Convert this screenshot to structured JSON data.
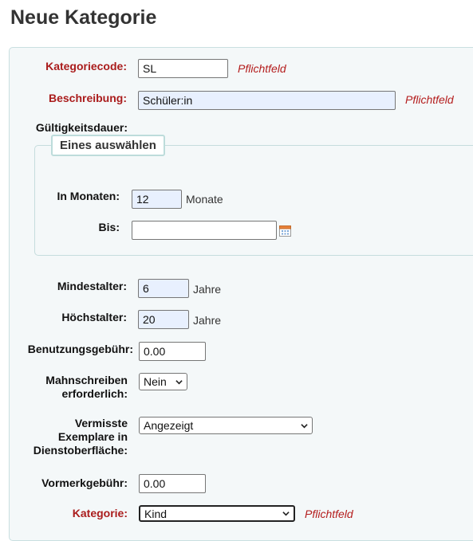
{
  "page": {
    "title": "Neue Kategorie"
  },
  "form": {
    "category_code": {
      "label": "Kategoriecode:",
      "value": "SL",
      "required": "Pflichtfeld"
    },
    "description": {
      "label": "Beschreibung:",
      "value": "Schüler:in",
      "required": "Pflichtfeld"
    },
    "validity": {
      "label": "Gültigkeitsdauer:",
      "legend": "Eines auswählen",
      "months": {
        "label": "In Monaten:",
        "value": "12",
        "unit": "Monate"
      },
      "until": {
        "label": "Bis:",
        "value": "",
        "icon": "calendar-icon"
      }
    },
    "min_age": {
      "label": "Mindestalter:",
      "value": "6",
      "unit": "Jahre"
    },
    "max_age": {
      "label": "Höchstalter:",
      "value": "20",
      "unit": "Jahre"
    },
    "fee": {
      "label": "Benutzungsgebühr:",
      "value": "0.00"
    },
    "overdue_notice": {
      "label_line1": "Mahnschreiben",
      "label_line2": "erforderlich:",
      "selected": "Nein"
    },
    "lost_items": {
      "label_line1": "Vermisste",
      "label_line2": "Exemplare in",
      "label_line3": "Dienstoberfläche:",
      "selected": "Angezeigt"
    },
    "reserve_fee": {
      "label": "Vormerkgebühr:",
      "value": "0.00"
    },
    "category": {
      "label": "Kategorie:",
      "selected": "Kind",
      "required": "Pflichtfeld"
    }
  },
  "colors": {
    "required_label": "#aa1c1c",
    "required_note": "#b41d1d",
    "autofill_bg": "#e8f0fe",
    "panel_bg": "#f4f8f9"
  }
}
